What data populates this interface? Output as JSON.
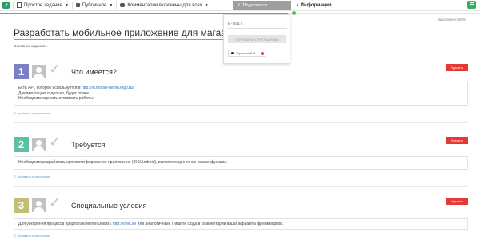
{
  "toolbar": {
    "task_type": "Простое задание",
    "visibility": "Публичное",
    "comments": "Комментарии включены для всех",
    "share": "Поделиться",
    "info": "Информация"
  },
  "progress": {
    "label": "Выполнено: 60%",
    "value": 0.6
  },
  "share_panel": {
    "email_placeholder": "E-mail",
    "send_button": "ОТПРАВИТЬ ПРИГЛАШЕНИЕ",
    "chip_label": "Справочный М."
  },
  "page": {
    "title": "Разработать мобильное приложение для магазина",
    "description": "Описание задания..."
  },
  "sections": [
    {
      "number": "1",
      "title": "Что имеется?",
      "delete": "Удалить",
      "line1_prefix": "Есть API, которое используется в ",
      "line1_link": "http://m.mobile-demo.logo.ru/",
      "line2": "Документацию отдельно, будет позже.",
      "line3": "Необходимо оценить стоимость работы.",
      "attach": "добавить приложение"
    },
    {
      "number": "2",
      "title": "Требуется",
      "delete": "Удалить",
      "text": "Необходимо разработать кроссплатформенное приложение (iOS/Android), выполняющее те же самые функции.",
      "attach": "добавить приложение"
    },
    {
      "number": "3",
      "title": "Специальные условия",
      "delete": "Удалить",
      "text_prefix": "Для ускорения процесса предлагаю использовать ",
      "link": "http://ionic.io/",
      "text_suffix": " или аналогичный. Пишите сюда в комментарии ваши варианты фреймворков.",
      "attach": "добавить приложение"
    }
  ],
  "colors": {
    "num1": "#7b80c4",
    "num2": "#5cc0a4",
    "num3": "#c6bd74",
    "delete": "#e53935",
    "progress": "#5cb85c"
  }
}
